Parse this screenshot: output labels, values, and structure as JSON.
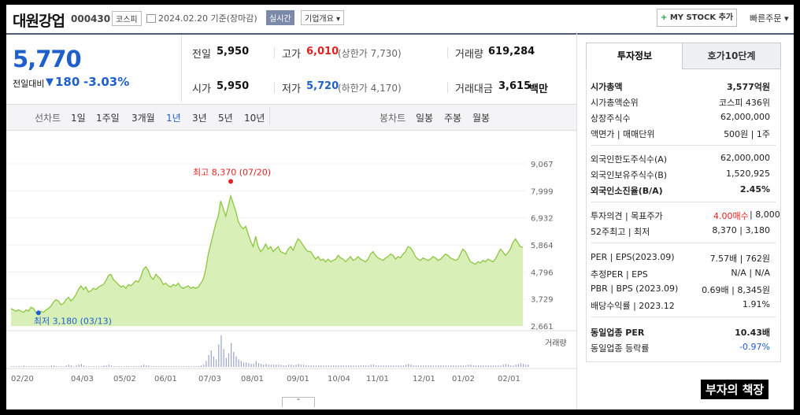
{
  "header": {
    "company_name": "대원강업",
    "code": "000430",
    "market": "코스피",
    "date": "2024.02.20 기준(장마감)",
    "live_label": "실시간",
    "corp_info_label": "기업개요",
    "mystock_label": "MY STOCK 추가",
    "quick_order_label": "빠른주문"
  },
  "price": {
    "current": "5,770",
    "change_label": "전일대비",
    "change": "180",
    "change_pct": "-3.03%"
  },
  "stats": {
    "prev_label": "전일",
    "prev": "5,950",
    "high_label": "고가",
    "high": "6,010",
    "high_limit": "(상한가 7,730)",
    "volume_label": "거래량",
    "volume": "619,284",
    "open_label": "시가",
    "open": "5,950",
    "low_label": "저가",
    "low": "5,720",
    "low_limit": "(하한가 4,170)",
    "amount_label": "거래대금",
    "amount": "3,615",
    "amount_unit": "백만"
  },
  "periods": {
    "line_label": "선차트",
    "items": [
      "1일",
      "1주일",
      "3개월",
      "1년",
      "3년",
      "5년",
      "10년"
    ],
    "selected": "1년",
    "candle_label": "봉차트",
    "candle_items": [
      "일봉",
      "주봉",
      "월봉"
    ]
  },
  "colors": {
    "line": "#8cc63f",
    "fill": "#d8f0b8",
    "high": "#e02222",
    "low": "#1f5fcc"
  },
  "chart_data": {
    "type": "area",
    "yticks": [
      "9,067",
      "7,999",
      "6,932",
      "5,864",
      "4,796",
      "3,729",
      "2,661"
    ],
    "ylim": [
      2661,
      9067
    ],
    "xticks": [
      "02/20",
      "04/03",
      "05/02",
      "06/01",
      "07/03",
      "08/01",
      "09/01",
      "10/04",
      "11/01",
      "12/01",
      "01/02",
      "02/01"
    ],
    "max_label": "최고 8,370 (07/20)",
    "min_label": "최저 3,180 (03/13)",
    "volume_label": "거래량",
    "values": [
      3350,
      3300,
      3250,
      3300,
      3250,
      3200,
      3300,
      3250,
      3400,
      3350,
      3200,
      3180,
      3250,
      3200,
      3300,
      3350,
      3450,
      3600,
      3700,
      3650,
      3500,
      3550,
      3700,
      3800,
      3650,
      3750,
      3900,
      4100,
      4250,
      4100,
      4200,
      4000,
      4050,
      4150,
      4100,
      4200,
      4250,
      4300,
      4450,
      4650,
      4700,
      4500,
      4400,
      4300,
      4200,
      4250,
      4150,
      4300,
      4250,
      4350,
      4450,
      4400,
      4600,
      4900,
      5000,
      4850,
      4600,
      4500,
      4700,
      4600,
      4500,
      4300,
      4350,
      4250,
      4200,
      4300,
      4250,
      4350,
      4200,
      4150,
      4200,
      4250,
      4150,
      4200,
      4150,
      4200,
      4350,
      4500,
      4900,
      5500,
      5900,
      6300,
      6700,
      7000,
      7600,
      7300,
      7000,
      7400,
      7800,
      7500,
      7200,
      6800,
      6600,
      6500,
      6600,
      6300,
      6000,
      5800,
      6200,
      5800,
      5600,
      5700,
      5900,
      5700,
      5800,
      5600,
      5700,
      5800,
      5600,
      5550,
      5500,
      5700,
      5800,
      5650,
      5900,
      6100,
      6000,
      5850,
      5700,
      5600,
      5600,
      5450,
      5300,
      5400,
      5250,
      5300,
      5200,
      5300,
      5200,
      5250,
      5300,
      5450,
      5350,
      5300,
      5200,
      5300,
      5400,
      5250,
      5300,
      5400,
      5300,
      5250,
      5200,
      5300,
      5500,
      5600,
      5450,
      5350,
      5300,
      5250,
      5350,
      5400,
      5500,
      5450,
      5300,
      5400,
      5350,
      5500,
      5600,
      5800,
      5750,
      5600,
      5400,
      5300,
      5250,
      5350,
      5300,
      5250,
      5300,
      5400,
      5350,
      5250,
      5300,
      5400,
      5500,
      5450,
      5350,
      5300,
      5250,
      5300,
      5500,
      5700,
      5600,
      5400,
      5200,
      5150,
      5100,
      5200,
      5150,
      5250,
      5200,
      5300,
      5250,
      5200,
      5300,
      5500,
      5700,
      5600,
      5450,
      5550,
      5700,
      5950,
      6100,
      5950,
      5800,
      5770
    ],
    "volumes": [
      1,
      1,
      1,
      1,
      1,
      2,
      1,
      1,
      1,
      1,
      1,
      1,
      1,
      1,
      1,
      1,
      2,
      2,
      1,
      1,
      1,
      1,
      2,
      3,
      2,
      1,
      2,
      3,
      4,
      2,
      1,
      1,
      1,
      1,
      1,
      1,
      1,
      2,
      2,
      3,
      2,
      1,
      1,
      1,
      1,
      1,
      1,
      1,
      1,
      1,
      1,
      1,
      2,
      3,
      2,
      2,
      1,
      1,
      1,
      1,
      1,
      1,
      1,
      1,
      1,
      1,
      1,
      1,
      1,
      1,
      1,
      1,
      1,
      1,
      1,
      1,
      2,
      3,
      8,
      16,
      22,
      14,
      10,
      30,
      42,
      24,
      12,
      18,
      32,
      20,
      14,
      10,
      8,
      6,
      6,
      5,
      4,
      4,
      8,
      5,
      4,
      3,
      4,
      3,
      3,
      3,
      3,
      3,
      3,
      2,
      2,
      3,
      3,
      2,
      3,
      4,
      3,
      3,
      2,
      2,
      2,
      2,
      2,
      2,
      2,
      2,
      2,
      2,
      2,
      2,
      2,
      2,
      2,
      2,
      2,
      2,
      2,
      2,
      2,
      2,
      2,
      2,
      2,
      2,
      3,
      3,
      2,
      2,
      2,
      2,
      2,
      2,
      2,
      2,
      2,
      2,
      2,
      2,
      3,
      4,
      3,
      2,
      2,
      2,
      2,
      2,
      2,
      2,
      2,
      2,
      2,
      2,
      2,
      2,
      2,
      2,
      2,
      2,
      2,
      2,
      2,
      2,
      2,
      3,
      3,
      2,
      2,
      2,
      2,
      2,
      2,
      2,
      2,
      2,
      2,
      2,
      2,
      3,
      4,
      3,
      2,
      2,
      3,
      4,
      5,
      4,
      3,
      3
    ]
  },
  "right": {
    "tab1": "투자정보",
    "tab2": "호가10단계",
    "rows1": [
      {
        "label": "시가총액",
        "value": "3,577억원"
      },
      {
        "label": "시가총액순위",
        "value": "코스피 436위"
      },
      {
        "label": "상장주식수",
        "value": "62,000,000"
      },
      {
        "label": "액면가 | 매매단위",
        "value": "500원 | 1주"
      }
    ],
    "rows2": [
      {
        "label": "외국인한도주식수(A)",
        "value": "62,000,000"
      },
      {
        "label": "외국인보유주식수(B)",
        "value": "1,520,925"
      },
      {
        "label": "외국인소진율(B/A)",
        "value": "2.45%"
      }
    ],
    "rows3": [
      {
        "label": "투자의견 | 목표주가",
        "value_red": "4.00매수",
        "value": "| 8,000"
      },
      {
        "label": "52주최고 | 최저",
        "value": "8,370 | 3,180"
      }
    ],
    "rows4": [
      {
        "label": "PER | EPS(2023.09)",
        "value": "7.57배 | 762원"
      },
      {
        "label": "추정PER | EPS",
        "value": "N/A | N/A"
      },
      {
        "label": "PBR | BPS (2023.09)",
        "value": "0.69배 | 8,345원"
      },
      {
        "label": "배당수익률 | 2023.12",
        "value": "1.91%"
      }
    ],
    "rows5": [
      {
        "label": "동일업종 PER",
        "value": "10.43배"
      },
      {
        "label": "동일업종 등락률",
        "value": "-0.97%"
      }
    ]
  },
  "watermark": "부자의 책장"
}
